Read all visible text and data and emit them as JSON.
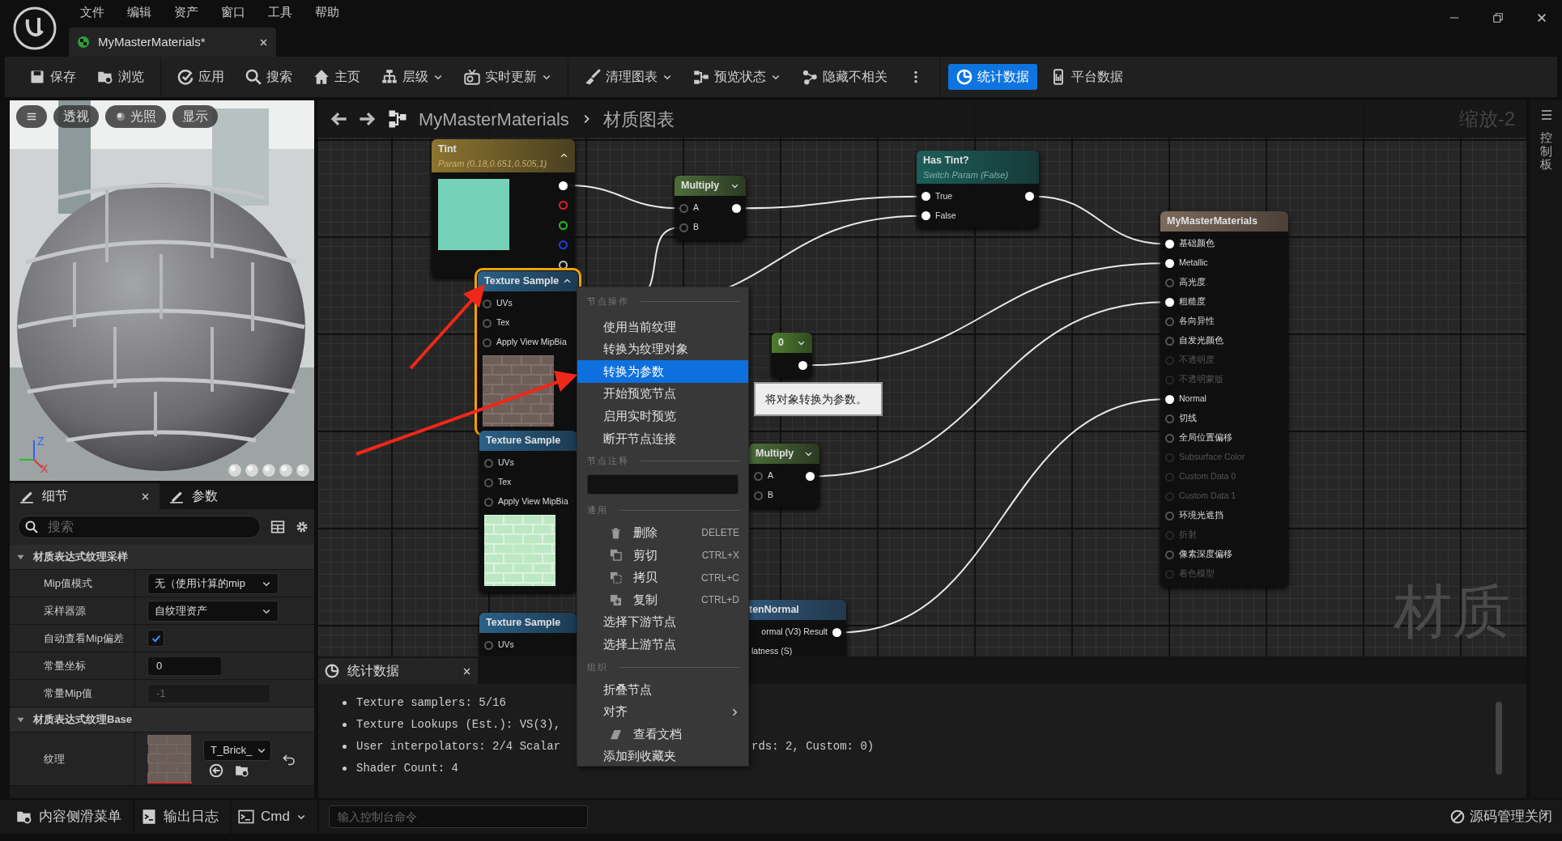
{
  "menu": [
    {
      "label": "文件"
    },
    {
      "label": "编辑"
    },
    {
      "label": "资产"
    },
    {
      "label": "窗口"
    },
    {
      "label": "工具"
    },
    {
      "label": "帮助"
    }
  ],
  "document_tab": {
    "title": "MyMasterMaterials*",
    "selected": true
  },
  "toolbar_groups": [
    {
      "items": [
        {
          "label": "保存",
          "dropdown": false,
          "selected": false
        },
        {
          "label": "浏览",
          "dropdown": false,
          "selected": false
        }
      ]
    },
    {
      "items": [
        {
          "label": "应用",
          "dropdown": false,
          "selected": false
        },
        {
          "label": "搜索",
          "dropdown": false,
          "selected": false
        },
        {
          "label": "主页",
          "dropdown": false,
          "selected": false
        },
        {
          "label": "层级",
          "dropdown": true,
          "selected": false
        },
        {
          "label": "实时更新",
          "dropdown": true,
          "selected": false
        }
      ]
    },
    {
      "items": [
        {
          "label": "清理图表",
          "dropdown": true,
          "selected": false
        },
        {
          "label": "预览状态",
          "dropdown": true,
          "selected": false
        },
        {
          "label": "隐藏不相关",
          "dropdown": false,
          "selected": false
        }
      ]
    },
    {
      "items": [
        {
          "label": "统计数据",
          "dropdown": false,
          "selected": true
        },
        {
          "label": "平台数据",
          "dropdown": false,
          "selected": false
        }
      ]
    }
  ],
  "viewport": {
    "buttons": [
      {
        "label": "透视"
      },
      {
        "label": "光照"
      },
      {
        "label": "显示"
      }
    ],
    "axes": [
      {
        "label": "Z",
        "color": "#3060ff"
      },
      {
        "label": "X",
        "color": "#e03030"
      }
    ]
  },
  "details": {
    "tabs": [
      {
        "label": "细节",
        "selected": true,
        "closable": true
      },
      {
        "label": "参数",
        "selected": false,
        "closable": false
      }
    ],
    "search": {
      "placeholder": "搜索"
    },
    "sections": [
      {
        "title": "材质表达式纹理采样",
        "expanded": true,
        "rows": [
          {
            "label": "Mip值模式",
            "kind": "dropdown",
            "value": "无（使用计算的mip"
          },
          {
            "label": "采样器源",
            "kind": "dropdown",
            "value": "自纹理资产"
          },
          {
            "label": "自动查看Mip偏差",
            "kind": "checkbox",
            "checked": true
          },
          {
            "label": "常量坐标",
            "kind": "number",
            "value": "0",
            "disabled": false
          },
          {
            "label": "常量Mip值",
            "kind": "number",
            "value": "-1",
            "disabled": true
          }
        ]
      },
      {
        "title": "材质表达式纹理Base",
        "expanded": true,
        "rows": [
          {
            "label": "纹理",
            "kind": "asset",
            "value": "T_Brick_"
          }
        ]
      }
    ]
  },
  "graph": {
    "breadcrumb": [
      "MyMasterMaterials",
      "材质图表"
    ],
    "zoom": "缩放-2",
    "watermark": "材质",
    "side_panel": {
      "label": "控制板"
    },
    "nodes": [
      {
        "kind": "param",
        "title": "Tint",
        "subtitle": "Param (0.18,0.651,0.505,1)",
        "color": "#76d1b9",
        "selected": false,
        "expanded": true,
        "rows": [
          {
            "output": {
              "connected": true,
              "color": "#ffffff"
            }
          },
          {
            "output": {
              "connected": false,
              "color": "#e02020"
            }
          },
          {
            "output": {
              "connected": false,
              "color": "#20c020"
            }
          },
          {
            "output": {
              "connected": false,
              "color": "#2040e0"
            }
          },
          {
            "output": {
              "connected": false,
              "color": "#c0c0c0"
            }
          }
        ]
      },
      {
        "kind": "math",
        "title": "Multiply",
        "selected": false,
        "expanded": false,
        "rows": [
          {
            "input": {
              "label": "A",
              "connected": false
            },
            "output": {
              "connected": true
            }
          },
          {
            "input": {
              "label": "B",
              "connected": false
            }
          }
        ]
      },
      {
        "kind": "switch",
        "title": "Has Tint?",
        "subtitle": "Switch Param (False)",
        "selected": false,
        "rows": [
          {
            "input": {
              "label": "True",
              "connected": true
            },
            "output": {
              "connected": true
            }
          },
          {
            "input": {
              "label": "False",
              "connected": true
            }
          }
        ]
      },
      {
        "kind": "output",
        "title": "MyMasterMaterials",
        "selected": false,
        "rows": [
          {
            "input": {
              "label": "基础颜色",
              "connected": true,
              "disabled": false
            }
          },
          {
            "input": {
              "label": "Metallic",
              "connected": true,
              "disabled": false
            }
          },
          {
            "input": {
              "label": "高光度",
              "connected": false,
              "disabled": false
            }
          },
          {
            "input": {
              "label": "粗糙度",
              "connected": true,
              "disabled": false
            }
          },
          {
            "input": {
              "label": "各向异性",
              "connected": false,
              "disabled": false
            }
          },
          {
            "input": {
              "label": "自发光颜色",
              "connected": false,
              "disabled": false
            }
          },
          {
            "input": {
              "label": "不透明度",
              "connected": false,
              "disabled": true
            }
          },
          {
            "input": {
              "label": "不透明蒙版",
              "connected": false,
              "disabled": true
            }
          },
          {
            "input": {
              "label": "Normal",
              "connected": true,
              "disabled": false
            }
          },
          {
            "input": {
              "label": "切线",
              "connected": false,
              "disabled": false
            }
          },
          {
            "input": {
              "label": "全局位置偏移",
              "connected": false,
              "disabled": false
            }
          },
          {
            "input": {
              "label": "Subsurface Color",
              "connected": false,
              "disabled": true
            }
          },
          {
            "input": {
              "label": "Custom Data 0",
              "connected": false,
              "disabled": true
            }
          },
          {
            "input": {
              "label": "Custom Data 1",
              "connected": false,
              "disabled": true
            }
          },
          {
            "input": {
              "label": "环境光遮挡",
              "connected": false,
              "disabled": false
            }
          },
          {
            "input": {
              "label": "折射",
              "connected": false,
              "disabled": true
            }
          },
          {
            "input": {
              "label": "像素深度偏移",
              "connected": false,
              "disabled": false
            }
          },
          {
            "input": {
              "label": "着色模型",
              "connected": false,
              "disabled": true
            }
          }
        ]
      },
      {
        "kind": "texture",
        "title": "Texture Sample",
        "selected": true,
        "expanded": true,
        "preview": true,
        "rows": [
          {
            "input": {
              "label": "UVs",
              "connected": false
            }
          },
          {
            "input": {
              "label": "Tex",
              "connected": false
            }
          },
          {
            "input": {
              "label": "Apply View MipBia",
              "connected": false
            }
          }
        ]
      },
      {
        "kind": "constant",
        "title": "0",
        "selected": false,
        "expanded": false,
        "rows": [
          {
            "output": {
              "connected": true
            }
          }
        ]
      },
      {
        "kind": "texture",
        "title": "Texture Sample",
        "selected": false,
        "preview": true,
        "rows": [
          {
            "input": {
              "label": "UVs",
              "connected": false
            }
          },
          {
            "input": {
              "label": "Tex",
              "connected": false
            }
          },
          {
            "input": {
              "label": "Apply View MipBia",
              "connected": false
            }
          }
        ]
      },
      {
        "kind": "math",
        "title": "Multiply",
        "selected": false,
        "expanded": false,
        "rows": [
          {
            "input": {
              "label": "A",
              "connected": false
            },
            "output": {
              "connected": true
            }
          },
          {
            "input": {
              "label": "B",
              "connected": false
            }
          }
        ]
      },
      {
        "kind": "texture",
        "title": "Texture Sample",
        "selected": false,
        "preview": false,
        "rows": [
          {
            "input": {
              "label": "UVs",
              "connected": false
            }
          }
        ]
      },
      {
        "kind": "function",
        "title": "tenNormal",
        "selected": false,
        "rows": [
          {
            "output": {
              "label": "ormal (V3) Result",
              "connected": true
            }
          },
          {
            "input": {
              "label": "latness (S)"
            }
          }
        ]
      }
    ]
  },
  "context_menu": {
    "sections": [
      {
        "heading": "节点操作",
        "kind": "actions",
        "items": [
          {
            "label": "使用当前纹理",
            "selected": false
          },
          {
            "label": "转换为纹理对象",
            "selected": false
          },
          {
            "label": "转换为参数",
            "selected": true
          },
          {
            "label": "开始预览节点",
            "selected": false
          },
          {
            "label": "启用实时预览",
            "selected": false
          },
          {
            "label": "断开节点连接",
            "selected": false
          }
        ]
      },
      {
        "heading": "节点注释",
        "kind": "comment"
      },
      {
        "heading": "通用",
        "kind": "actions",
        "items": [
          {
            "label": "删除",
            "shortcut": "DELETE",
            "selected": false
          },
          {
            "label": "剪切",
            "shortcut": "CTRL+X",
            "selected": false
          },
          {
            "label": "拷贝",
            "shortcut": "CTRL+C",
            "selected": false
          },
          {
            "label": "复制",
            "shortcut": "CTRL+D",
            "selected": false
          },
          {
            "label": "选择下游节点",
            "selected": false
          },
          {
            "label": "选择上游节点",
            "selected": false
          }
        ]
      },
      {
        "heading": "组织",
        "kind": "actions",
        "items": [
          {
            "label": "折叠节点",
            "selected": false,
            "submenu": false
          },
          {
            "label": "对齐",
            "selected": false,
            "submenu": true
          },
          {
            "label": "查看文档",
            "selected": false,
            "submenu": false
          },
          {
            "label": "添加到收藏夹",
            "selected": false,
            "submenu": false
          }
        ]
      }
    ]
  },
  "tooltip": {
    "text": "将对象转换为参数。"
  },
  "stats": {
    "tab": {
      "label": "统计数据"
    },
    "lines": [
      {
        "text": "Texture samplers: 5/16"
      },
      {
        "text": "Texture Lookups (Est.): VS(3),"
      },
      {
        "text": "User interpolators: 2/4 Scalar",
        "tail": "rds: 2, Custom: 0)"
      },
      {
        "text": "Shader Count: 4"
      }
    ]
  },
  "status_bar": {
    "buttons": [
      {
        "label": "内容侧滑菜单"
      },
      {
        "label": "输出日志"
      }
    ],
    "cmd": {
      "label": "Cmd"
    },
    "console": {
      "placeholder": "输入控制台命令"
    },
    "source_control": {
      "label": "源码管理关闭"
    }
  }
}
